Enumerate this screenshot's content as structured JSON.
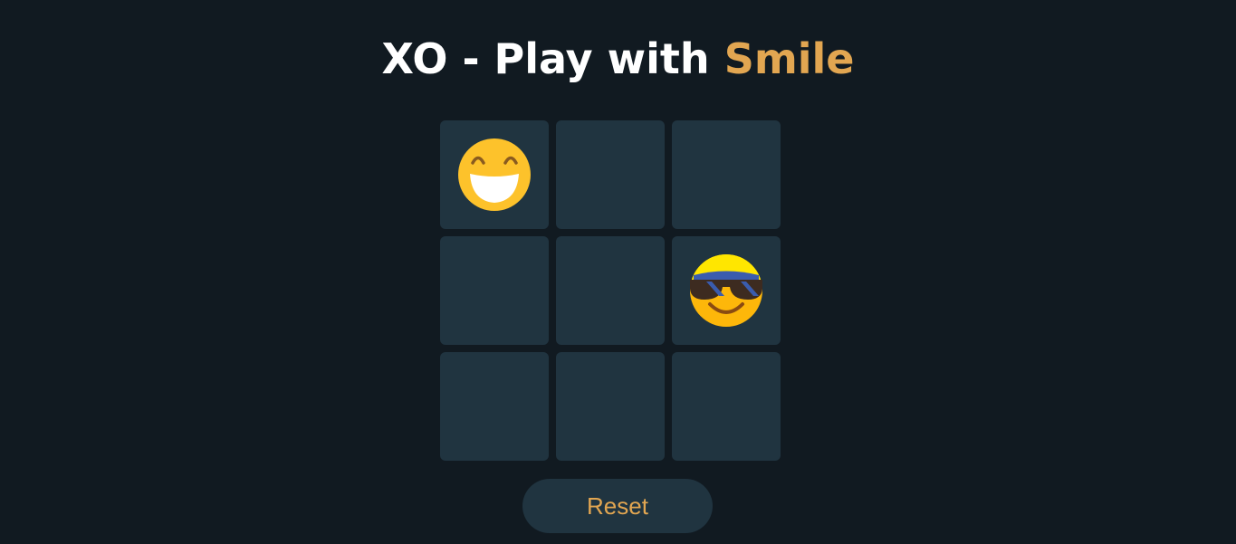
{
  "header": {
    "title_main": "XO - Play with ",
    "title_accent": "Smile"
  },
  "colors": {
    "background": "#111a21",
    "cell": "#203440",
    "accent": "#e2a651",
    "text": "#ffffff"
  },
  "board": {
    "cells": [
      {
        "mark": "grinning-face-icon"
      },
      {
        "mark": ""
      },
      {
        "mark": ""
      },
      {
        "mark": ""
      },
      {
        "mark": ""
      },
      {
        "mark": "sunglasses-face-icon"
      },
      {
        "mark": ""
      },
      {
        "mark": ""
      },
      {
        "mark": ""
      }
    ]
  },
  "controls": {
    "reset_label": "Reset"
  }
}
